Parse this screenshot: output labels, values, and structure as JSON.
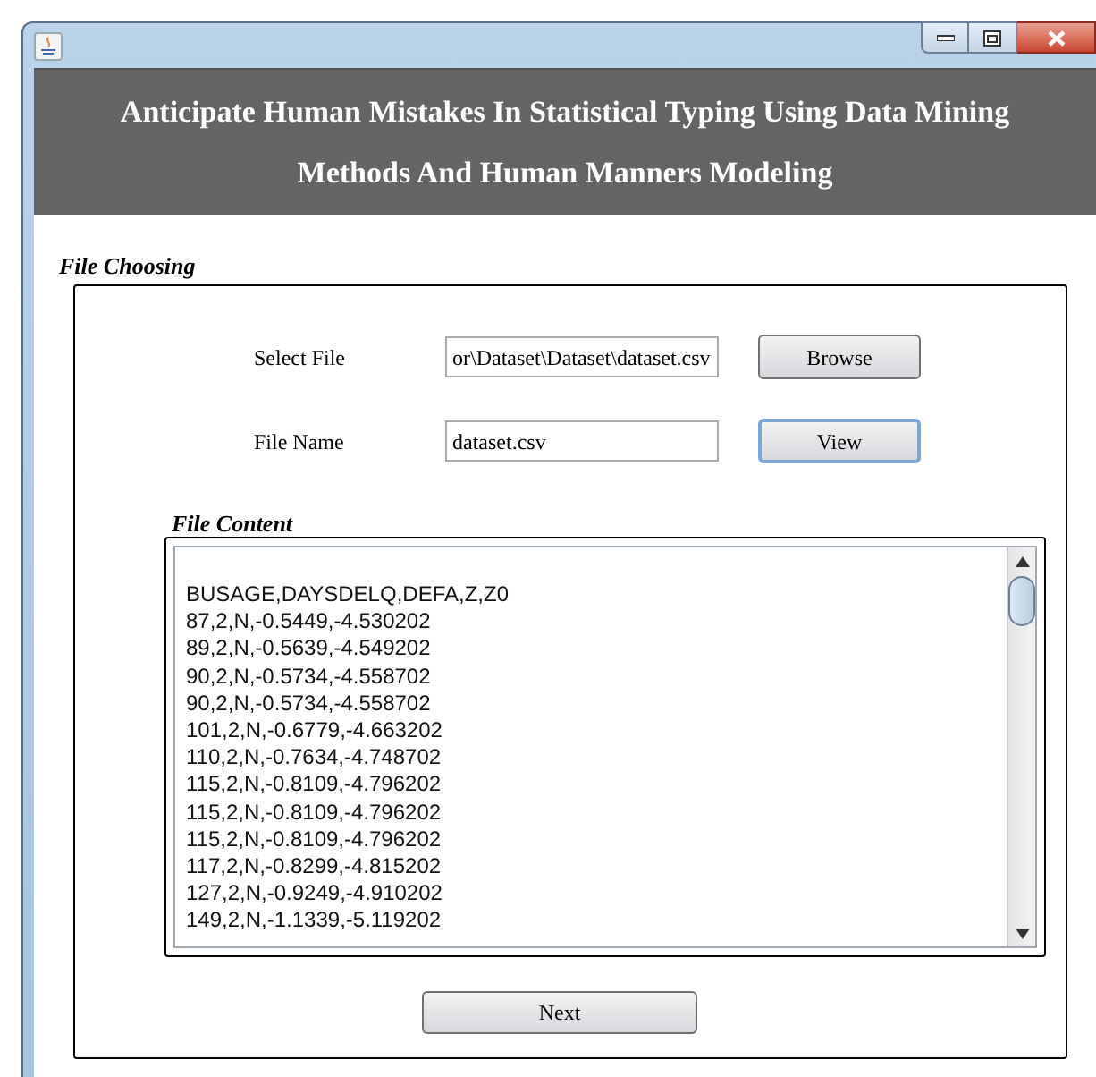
{
  "window": {
    "controls": [
      {
        "kind": "minimize"
      },
      {
        "kind": "maximize"
      },
      {
        "kind": "close"
      }
    ]
  },
  "header": {
    "lines": [
      "Anticipate Human Mistakes In Statistical Typing Using Data Mining",
      "Methods And Human Manners Modeling"
    ]
  },
  "file_choosing": {
    "title": "File Choosing",
    "rows": [
      {
        "label": "Select File",
        "value": "or\\Dataset\\Dataset\\dataset.csv",
        "button": "Browse",
        "focused": false
      },
      {
        "label": "File Name",
        "value": "dataset.csv",
        "button": "View",
        "focused": true
      }
    ],
    "file_content": {
      "title": "File Content",
      "lines": [
        "BUSAGE,DAYSDELQ,DEFA,Z,Z0",
        "87,2,N,-0.5449,-4.530202",
        "89,2,N,-0.5639,-4.549202",
        "90,2,N,-0.5734,-4.558702",
        "90,2,N,-0.5734,-4.558702",
        "101,2,N,-0.6779,-4.663202",
        "110,2,N,-0.7634,-4.748702",
        "115,2,N,-0.8109,-4.796202",
        "115,2,N,-0.8109,-4.796202",
        "115,2,N,-0.8109,-4.796202",
        "117,2,N,-0.8299,-4.815202",
        "127,2,N,-0.9249,-4.910202",
        "149,2,N,-1.1339,-5.119202"
      ]
    },
    "next_button": "Next"
  }
}
